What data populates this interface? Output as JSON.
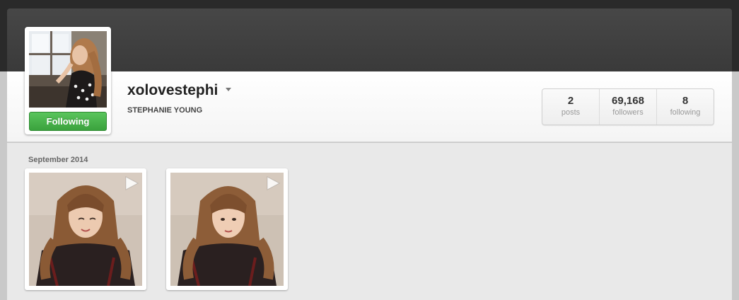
{
  "profile": {
    "username": "xolovestephi",
    "full_name": "STEPHANIE YOUNG",
    "follow_button_label": "Following",
    "follow_button_color": "#43b046"
  },
  "stats": [
    {
      "value": "2",
      "label": "posts"
    },
    {
      "value": "69,168",
      "label": "followers"
    },
    {
      "value": "8",
      "label": "following"
    }
  ],
  "feed": {
    "month_label": "September 2014",
    "items": [
      {
        "type": "video",
        "icon": "play-icon"
      },
      {
        "type": "video",
        "icon": "play-icon"
      }
    ]
  },
  "colors": {
    "cover": "#404040",
    "header": "#ffffff",
    "content": "#e9e9e9"
  }
}
